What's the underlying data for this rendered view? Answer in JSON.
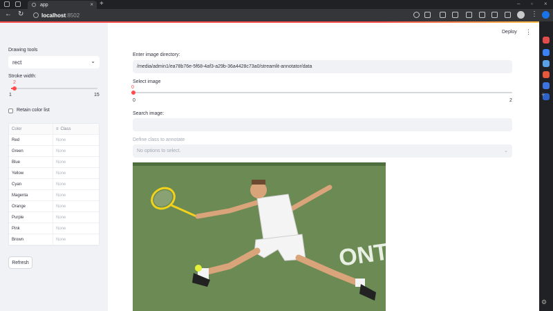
{
  "browser": {
    "tab_title": "app",
    "tab_close": "×",
    "new_tab": "+",
    "minimize": "–",
    "maximize": "▫",
    "close": "×",
    "url_host": "localhost",
    "url_port": ":8502",
    "back": "←",
    "refresh": "↻",
    "menu": "⋮"
  },
  "sidebar": {
    "drawing_tools_label": "Drawing tools",
    "drawing_tool_value": "rect",
    "stroke_width_label": "Stroke width:",
    "stroke_value": "2",
    "stroke_min": "1",
    "stroke_max": "15",
    "retain_label": "Retain color list",
    "table": {
      "headers": [
        "Color",
        "Class"
      ],
      "class_icon": "≡",
      "rows": [
        [
          "Red",
          "None"
        ],
        [
          "Green",
          "None"
        ],
        [
          "Blue",
          "None"
        ],
        [
          "Yellow",
          "None"
        ],
        [
          "Cyan",
          "None"
        ],
        [
          "Magenta",
          "None"
        ],
        [
          "Orange",
          "None"
        ],
        [
          "Purple",
          "None"
        ],
        [
          "Pink",
          "None"
        ],
        [
          "Brown",
          "None"
        ]
      ]
    },
    "refresh_label": "Refresh"
  },
  "main": {
    "deploy_label": "Deploy",
    "menu": "⋮",
    "dir_label": "Enter image directory:",
    "dir_value": "/media/admin1/ea78b76e-5f68-4af3-a29b-36a4428c73a0/streamlit-annotator/data",
    "select_image_label": "Select image",
    "select_image_value": "0",
    "select_image_min": "0",
    "select_image_max": "2",
    "search_label": "Search image:",
    "search_value": "",
    "class_label": "Define class to annotate",
    "class_placeholder": "No options to select.",
    "photo_text": "ONT"
  },
  "colors": {
    "accent": "#ff4b4b",
    "sidebar_bg": "#f0f2f6",
    "court_green": "#6f8e57"
  }
}
